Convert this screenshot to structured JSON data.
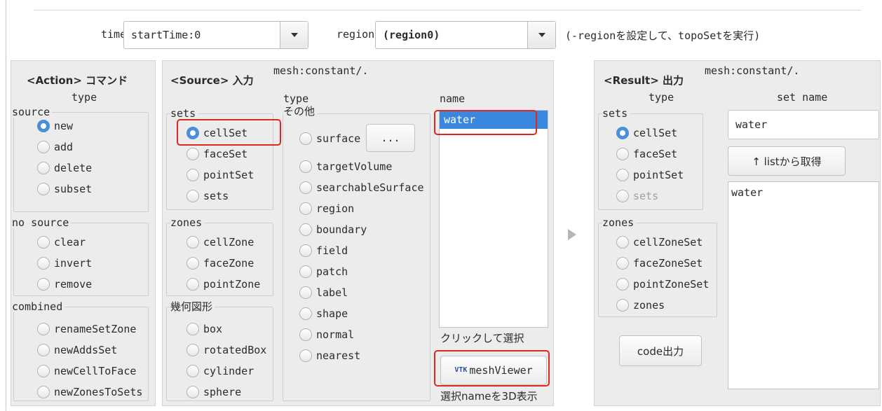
{
  "time": {
    "label": "time",
    "value": "startTime:0"
  },
  "region": {
    "label": "region",
    "value": "(region0)",
    "note": "(-regionを設定して、topoSetを実行)"
  },
  "action": {
    "title": "<Action> コマンド",
    "type_label": "type",
    "source": {
      "label": "source",
      "items": [
        "new",
        "add",
        "delete",
        "subset"
      ]
    },
    "nosource": {
      "label": "no source",
      "items": [
        "clear",
        "invert",
        "remove"
      ]
    },
    "combined": {
      "label": "combined",
      "items": [
        "renameSetZone",
        "newAddsSet",
        "newCellToFace",
        "newZonesToSets"
      ]
    }
  },
  "source": {
    "title": "<Source> 入力",
    "mesh": "mesh:constant/.",
    "sets": {
      "label": "sets",
      "items": [
        "cellSet",
        "faceSet",
        "pointSet",
        "sets"
      ]
    },
    "zones": {
      "label": "zones",
      "items": [
        "cellZone",
        "faceZone",
        "pointZone"
      ]
    },
    "geo": {
      "label": "幾何図形",
      "items": [
        "box",
        "rotatedBox",
        "cylinder",
        "sphere"
      ]
    },
    "type_label": "type",
    "other": {
      "label": "その他",
      "items": [
        "surface",
        "targetVolume",
        "searchableSurface",
        "region",
        "boundary",
        "field",
        "patch",
        "label",
        "shape",
        "normal",
        "nearest"
      ]
    },
    "ellipsis": "...",
    "name_label": "name",
    "names": [
      "water"
    ],
    "click_hint": "クリックして選択",
    "viewer_button": "meshViewer",
    "viewer_icon": "VTK",
    "viewer_hint": "選択nameを3D表示"
  },
  "result": {
    "title": "<Result> 出力",
    "mesh": "mesh:constant/.",
    "type_label": "type",
    "setname_label": "set name",
    "sets": {
      "label": "sets",
      "items": [
        "cellSet",
        "faceSet",
        "pointSet",
        "sets"
      ]
    },
    "zones": {
      "label": "zones",
      "items": [
        "cellZoneSet",
        "faceZoneSet",
        "pointZoneSet",
        "zones"
      ]
    },
    "setname_value": "water",
    "list_button": "↑ listから取得",
    "list_items": [
      "water"
    ],
    "code_button": "code出力"
  },
  "colors": {
    "accent": "#3a87e0",
    "highlight": "#e0281f",
    "panel": "#ececec"
  }
}
